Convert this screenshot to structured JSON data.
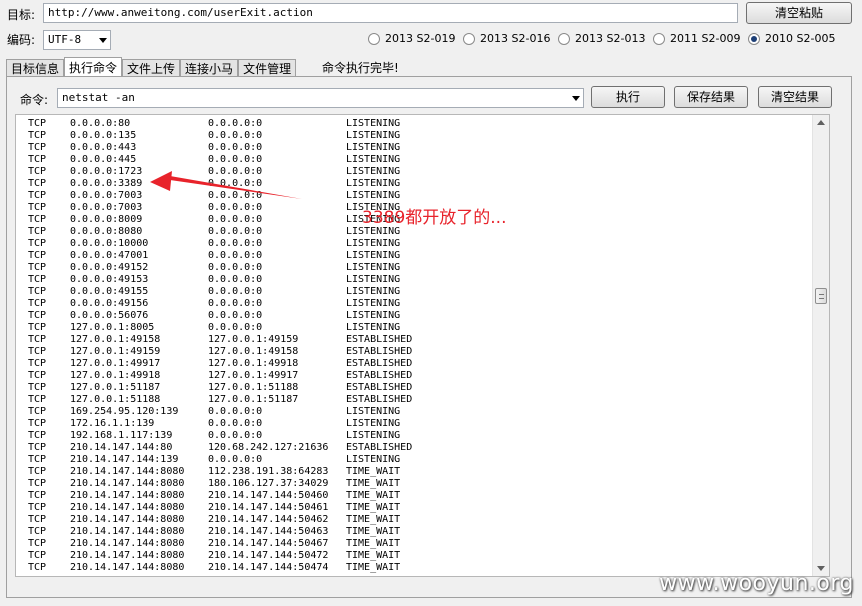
{
  "target": {
    "label": "目标:",
    "url": "http://www.anweitong.com/userExit.action",
    "clear_paste_label": "清空粘贴"
  },
  "encoding": {
    "label": "编码:",
    "value": "UTF-8"
  },
  "exploits": [
    {
      "label": "2013 S2-019",
      "selected": false
    },
    {
      "label": "2013 S2-016",
      "selected": false
    },
    {
      "label": "2013 S2-013",
      "selected": false
    },
    {
      "label": "2011 S2-009",
      "selected": false
    },
    {
      "label": "2010 S2-005",
      "selected": true
    }
  ],
  "tabs": [
    {
      "label": "目标信息",
      "active": false
    },
    {
      "label": "执行命令",
      "active": true
    },
    {
      "label": "文件上传",
      "active": false
    },
    {
      "label": "连接小马",
      "active": false
    },
    {
      "label": "文件管理",
      "active": false
    }
  ],
  "status": "命令执行完毕!",
  "command": {
    "label": "命令:",
    "value": "netstat -an",
    "execute_label": "执行",
    "save_label": "保存结果",
    "clear_label": "清空结果"
  },
  "netstat_rows": [
    [
      "TCP",
      "0.0.0.0:80",
      "0.0.0.0:0",
      "LISTENING"
    ],
    [
      "TCP",
      "0.0.0.0:135",
      "0.0.0.0:0",
      "LISTENING"
    ],
    [
      "TCP",
      "0.0.0.0:443",
      "0.0.0.0:0",
      "LISTENING"
    ],
    [
      "TCP",
      "0.0.0.0:445",
      "0.0.0.0:0",
      "LISTENING"
    ],
    [
      "TCP",
      "0.0.0.0:1723",
      "0.0.0.0:0",
      "LISTENING"
    ],
    [
      "TCP",
      "0.0.0.0:3389",
      "0.0.0.0:0",
      "LISTENING"
    ],
    [
      "TCP",
      "0.0.0.0:7003",
      "0.0.0.0:0",
      "LISTENING"
    ],
    [
      "TCP",
      "0.0.0.0:7003",
      "0.0.0.0:0",
      "LISTENING"
    ],
    [
      "TCP",
      "0.0.0.0:8009",
      "0.0.0.0:0",
      "LISTENING"
    ],
    [
      "TCP",
      "0.0.0.0:8080",
      "0.0.0.0:0",
      "LISTENING"
    ],
    [
      "TCP",
      "0.0.0.0:10000",
      "0.0.0.0:0",
      "LISTENING"
    ],
    [
      "TCP",
      "0.0.0.0:47001",
      "0.0.0.0:0",
      "LISTENING"
    ],
    [
      "TCP",
      "0.0.0.0:49152",
      "0.0.0.0:0",
      "LISTENING"
    ],
    [
      "TCP",
      "0.0.0.0:49153",
      "0.0.0.0:0",
      "LISTENING"
    ],
    [
      "TCP",
      "0.0.0.0:49155",
      "0.0.0.0:0",
      "LISTENING"
    ],
    [
      "TCP",
      "0.0.0.0:49156",
      "0.0.0.0:0",
      "LISTENING"
    ],
    [
      "TCP",
      "0.0.0.0:56076",
      "0.0.0.0:0",
      "LISTENING"
    ],
    [
      "TCP",
      "127.0.0.1:8005",
      "0.0.0.0:0",
      "LISTENING"
    ],
    [
      "TCP",
      "127.0.0.1:49158",
      "127.0.0.1:49159",
      "ESTABLISHED"
    ],
    [
      "TCP",
      "127.0.0.1:49159",
      "127.0.0.1:49158",
      "ESTABLISHED"
    ],
    [
      "TCP",
      "127.0.0.1:49917",
      "127.0.0.1:49918",
      "ESTABLISHED"
    ],
    [
      "TCP",
      "127.0.0.1:49918",
      "127.0.0.1:49917",
      "ESTABLISHED"
    ],
    [
      "TCP",
      "127.0.0.1:51187",
      "127.0.0.1:51188",
      "ESTABLISHED"
    ],
    [
      "TCP",
      "127.0.0.1:51188",
      "127.0.0.1:51187",
      "ESTABLISHED"
    ],
    [
      "TCP",
      "169.254.95.120:139",
      "0.0.0.0:0",
      "LISTENING"
    ],
    [
      "TCP",
      "172.16.1.1:139",
      "0.0.0.0:0",
      "LISTENING"
    ],
    [
      "TCP",
      "192.168.1.117:139",
      "0.0.0.0:0",
      "LISTENING"
    ],
    [
      "TCP",
      "210.14.147.144:80",
      "120.68.242.127:21636",
      "ESTABLISHED"
    ],
    [
      "TCP",
      "210.14.147.144:139",
      "0.0.0.0:0",
      "LISTENING"
    ],
    [
      "TCP",
      "210.14.147.144:8080",
      "112.238.191.38:64283",
      "TIME_WAIT"
    ],
    [
      "TCP",
      "210.14.147.144:8080",
      "180.106.127.37:34029",
      "TIME_WAIT"
    ],
    [
      "TCP",
      "210.14.147.144:8080",
      "210.14.147.144:50460",
      "TIME_WAIT"
    ],
    [
      "TCP",
      "210.14.147.144:8080",
      "210.14.147.144:50461",
      "TIME_WAIT"
    ],
    [
      "TCP",
      "210.14.147.144:8080",
      "210.14.147.144:50462",
      "TIME_WAIT"
    ],
    [
      "TCP",
      "210.14.147.144:8080",
      "210.14.147.144:50463",
      "TIME_WAIT"
    ],
    [
      "TCP",
      "210.14.147.144:8080",
      "210.14.147.144:50467",
      "TIME_WAIT"
    ],
    [
      "TCP",
      "210.14.147.144:8080",
      "210.14.147.144:50472",
      "TIME_WAIT"
    ],
    [
      "TCP",
      "210.14.147.144:8080",
      "210.14.147.144:50474",
      "TIME_WAIT"
    ]
  ],
  "annotation": {
    "text": "3389都开放了的...",
    "color": "#e8232b"
  },
  "watermark": "www.wooyun.org"
}
